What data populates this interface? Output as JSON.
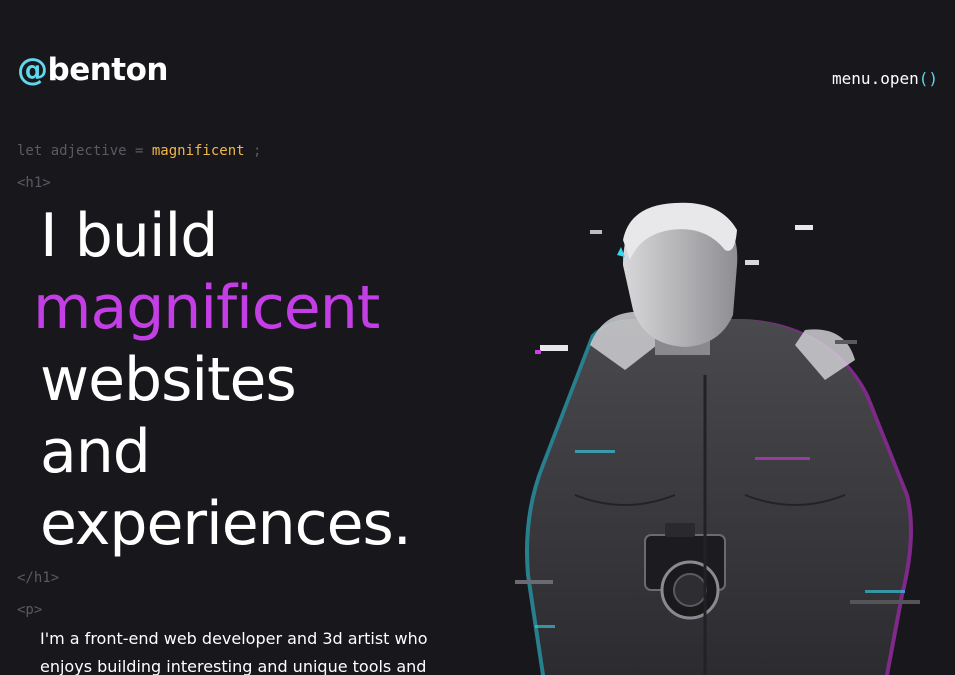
{
  "header": {
    "logo_at": "@",
    "logo_name": "benton",
    "menu_label": "menu.open",
    "menu_parens": "()"
  },
  "code_lines": {
    "let_prefix": "let adjective = ",
    "let_value": "magnificent",
    "let_suffix": " ;",
    "h1_open": "<h1>",
    "h1_close": "</h1>",
    "p_open": "<p>"
  },
  "hero": {
    "line1": "I build",
    "line2": "magnificent",
    "line3": "websites",
    "line4": "and",
    "line5": "experiences."
  },
  "bio": {
    "text": "I'm a front-end web developer and 3d artist who enjoys building interesting and unique tools and"
  },
  "colors": {
    "background": "#18171b",
    "accent_cyan": "#5fd8ee",
    "accent_magenta": "#c43ee6",
    "code_value": "#f0b64c",
    "code_gray": "#5b5a60"
  },
  "portrait": {
    "icon": "glitch-portrait-image"
  }
}
